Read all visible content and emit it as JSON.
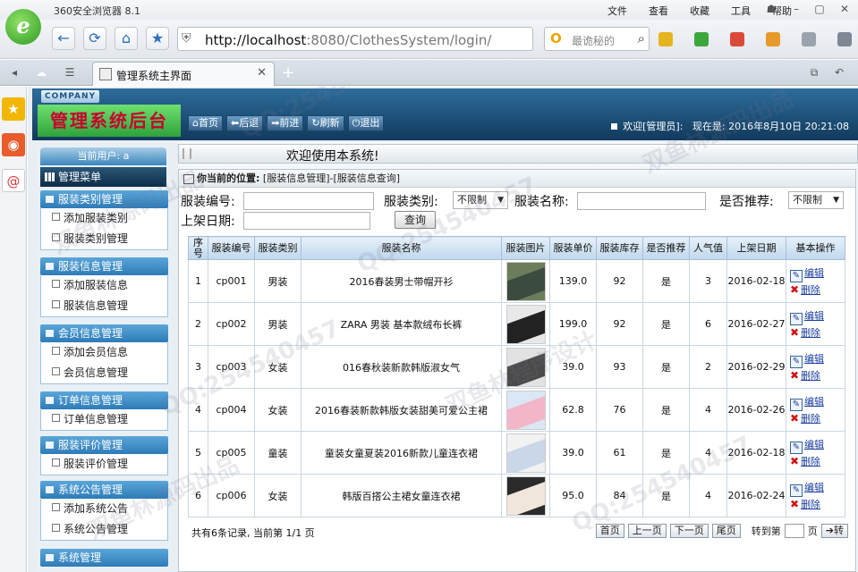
{
  "browser": {
    "title": "360安全浏览器 8.1",
    "menu": [
      "文件",
      "查看",
      "收藏",
      "工具",
      "帮助"
    ],
    "address_host": "http://localhost",
    "address_rest": ":8080/ClothesSystem/login/",
    "search_placeholder": "最诡秘的",
    "tab_title": "管理系统主界面"
  },
  "header": {
    "company": "COMPANY",
    "system_title": "管理系统后台",
    "buttons": [
      "首页",
      "后退",
      "前进",
      "刷新",
      "退出"
    ],
    "welcome_user": "欢迎[管理员]:",
    "now_label": "现在是: 2016年8月10日 20:21:08"
  },
  "sidebar": {
    "current_user": "当前用户: a",
    "main_menu": "管理菜单",
    "groups": [
      {
        "title": "服装类别管理",
        "items": [
          "添加服装类别",
          "服装类别管理"
        ]
      },
      {
        "title": "服装信息管理",
        "items": [
          "添加服装信息",
          "服装信息管理"
        ]
      },
      {
        "title": "会员信息管理",
        "items": [
          "添加会员信息",
          "会员信息管理"
        ]
      },
      {
        "title": "订单信息管理",
        "items": [
          "订单信息管理"
        ]
      },
      {
        "title": "服装评价管理",
        "items": [
          "服装评价管理"
        ]
      },
      {
        "title": "系统公告管理",
        "items": [
          "添加系统公告",
          "系统公告管理"
        ]
      },
      {
        "title": "系统管理",
        "items": []
      }
    ]
  },
  "content": {
    "welcome": "欢迎使用本系统!",
    "location_label": "你当前的位置:",
    "location_path": "[服装信息管理]-[服装信息查询]",
    "filters": {
      "code_label": "服装编号:",
      "category_label": "服装类别:",
      "category_value": "不限制",
      "name_label": "服装名称:",
      "recommend_label": "是否推荐:",
      "recommend_value": "不限制",
      "date_label": "上架日期:",
      "query_button": "查询"
    },
    "table": {
      "headers": [
        "序号",
        "服装编号",
        "服装类别",
        "服装名称",
        "服装图片",
        "服装单价",
        "服装库存",
        "是否推荐",
        "人气值",
        "上架日期",
        "基本操作"
      ],
      "rows": [
        {
          "no": "1",
          "code": "cp001",
          "category": "男装",
          "name": "2016春装男士带帽开衫",
          "price": "139.0",
          "stock": "92",
          "recommend": "是",
          "pop": "3",
          "date": "2016-02-18"
        },
        {
          "no": "2",
          "code": "cp002",
          "category": "男装",
          "name": "ZARA 男装 基本款绒布长裤",
          "price": "199.0",
          "stock": "92",
          "recommend": "是",
          "pop": "6",
          "date": "2016-02-27"
        },
        {
          "no": "3",
          "code": "cp003",
          "category": "女装",
          "name": "016春秋装新款韩版淑女气",
          "price": "39.0",
          "stock": "93",
          "recommend": "是",
          "pop": "2",
          "date": "2016-02-29"
        },
        {
          "no": "4",
          "code": "cp004",
          "category": "女装",
          "name": "2016春装新款韩版女装甜美可爱公主裙",
          "price": "62.8",
          "stock": "76",
          "recommend": "是",
          "pop": "4",
          "date": "2016-02-26"
        },
        {
          "no": "5",
          "code": "cp005",
          "category": "童装",
          "name": "童装女童夏装2016新款儿童连衣裙",
          "price": "39.0",
          "stock": "61",
          "recommend": "是",
          "pop": "4",
          "date": "2016-02-18"
        },
        {
          "no": "6",
          "code": "cp006",
          "category": "女装",
          "name": "韩版百搭公主裙女童连衣裙",
          "price": "95.0",
          "stock": "84",
          "recommend": "是",
          "pop": "4",
          "date": "2016-02-24"
        }
      ],
      "edit_label": "编辑",
      "delete_label": "删除"
    },
    "pager": {
      "info": "共有6条记录, 当前第 1/1 页",
      "first": "首页",
      "prev": "上一页",
      "next": "下一页",
      "last": "尾页",
      "goto_label": "转到第",
      "page_unit": "页",
      "go_button": "转"
    }
  },
  "watermarks": [
    "QQ:254540457",
    "双鱼林源码出品",
    "双鱼林程序设计"
  ],
  "colors": {
    "header_bg": "#1c4b72",
    "title_green": "#3ab34a",
    "title_red": "#c8002e",
    "group_blue": "#3d8ac5",
    "link_blue": "#1a3f9c"
  }
}
